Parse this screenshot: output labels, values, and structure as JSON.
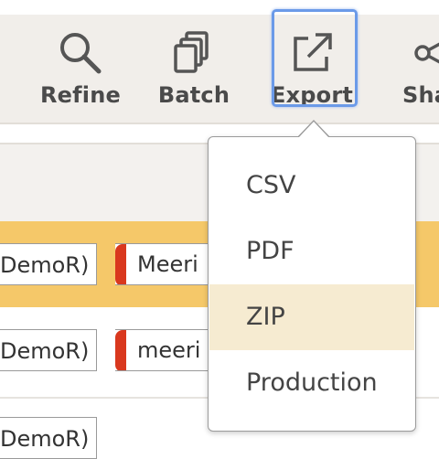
{
  "toolbar": {
    "refine_label": "Refine",
    "batch_label": "Batch",
    "export_label": "Export",
    "share_label": "Sha"
  },
  "rows": [
    {
      "cell": "DemoR)",
      "tag": "Meeri"
    },
    {
      "cell": "DemoR)",
      "tag": "meeri"
    },
    {
      "cell": "DemoR)"
    }
  ],
  "export_menu": {
    "items": [
      "CSV",
      "PDF",
      "ZIP",
      "Production"
    ],
    "highlighted": "ZIP"
  },
  "colors": {
    "selected_row": "#f5c869",
    "tag_accent": "#d9381e",
    "focus_ring": "#6b9ae8",
    "menu_highlight": "#f6ebd1"
  }
}
